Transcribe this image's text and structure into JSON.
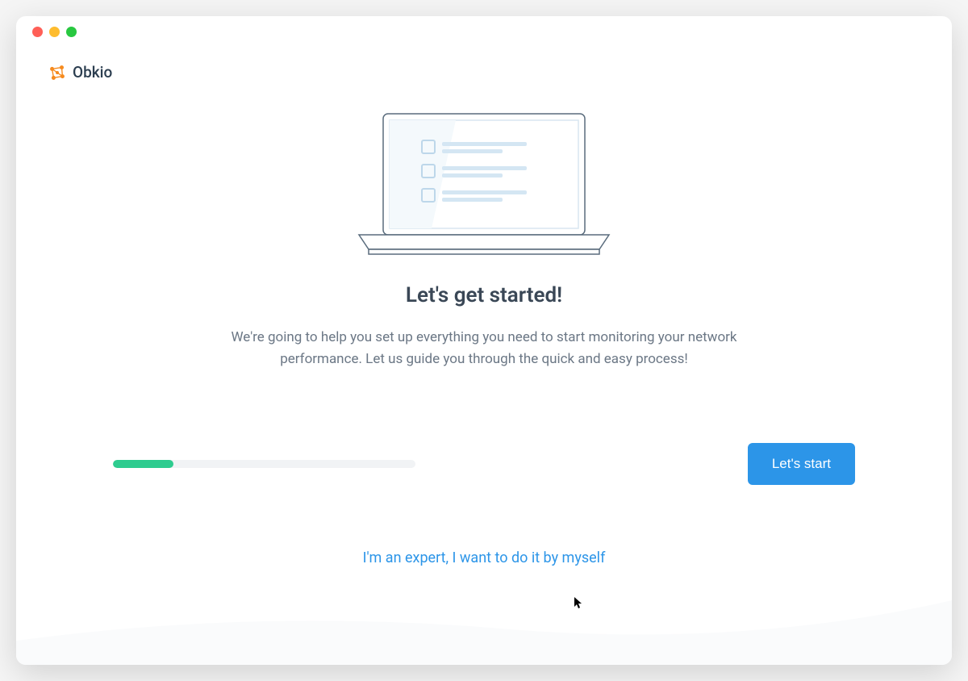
{
  "brand": {
    "name": "Obkio"
  },
  "onboarding": {
    "title": "Let's get started!",
    "description": "We're going to help you set up everything you need to start monitoring your network performance. Let us guide you through the quick and easy process!",
    "progress_percent": 20,
    "start_button_label": "Let's start",
    "skip_link_label": "I'm an expert, I want to do it by myself"
  },
  "colors": {
    "accent": "#2c95e8",
    "progress": "#2ecc8f",
    "brand_icon": "#f68b1f"
  }
}
